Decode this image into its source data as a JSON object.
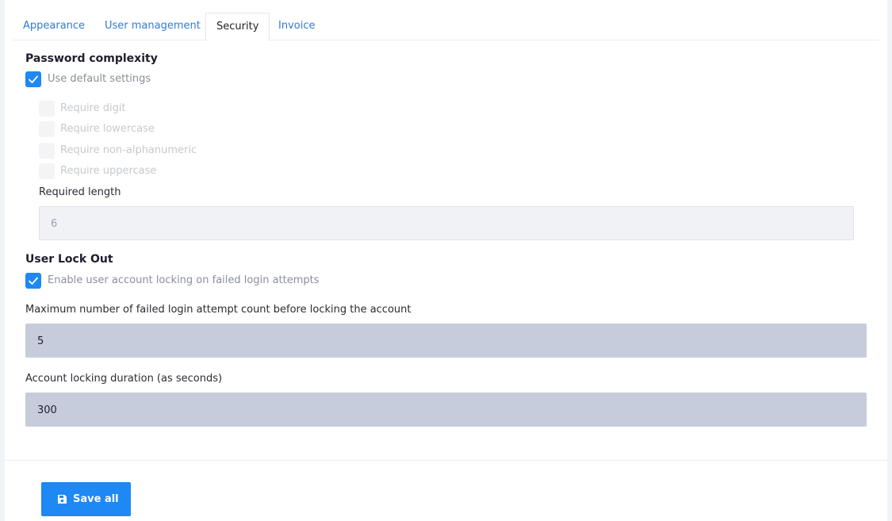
{
  "tabs": [
    {
      "label": "Appearance",
      "active": false
    },
    {
      "label": "User management",
      "active": false
    },
    {
      "label": "Security",
      "active": true
    },
    {
      "label": "Invoice",
      "active": false
    }
  ],
  "password_complexity": {
    "title": "Password complexity",
    "use_default": {
      "label": "Use default settings",
      "checked": true
    },
    "options": [
      {
        "label": "Require digit",
        "checked": false,
        "disabled": true
      },
      {
        "label": "Require lowercase",
        "checked": false,
        "disabled": true
      },
      {
        "label": "Require non-alphanumeric",
        "checked": false,
        "disabled": true
      },
      {
        "label": "Require uppercase",
        "checked": false,
        "disabled": true
      }
    ],
    "required_length": {
      "label": "Required length",
      "value": "6",
      "disabled": true
    }
  },
  "user_lockout": {
    "title": "User Lock Out",
    "enable": {
      "label": "Enable user account locking on failed login attempts",
      "checked": true
    },
    "max_attempts": {
      "label": "Maximum number of failed login attempt count before locking the account",
      "value": "5"
    },
    "duration": {
      "label": "Account locking duration (as seconds)",
      "value": "300"
    }
  },
  "footer": {
    "save_label": "Save all",
    "save_icon": "floppy-disk-icon"
  },
  "colors": {
    "accent": "#1e88f5",
    "tab_link": "#2f7bd6",
    "filled_input_bg": "#c7ccdc",
    "disabled_input_bg": "#f1f2f5"
  }
}
